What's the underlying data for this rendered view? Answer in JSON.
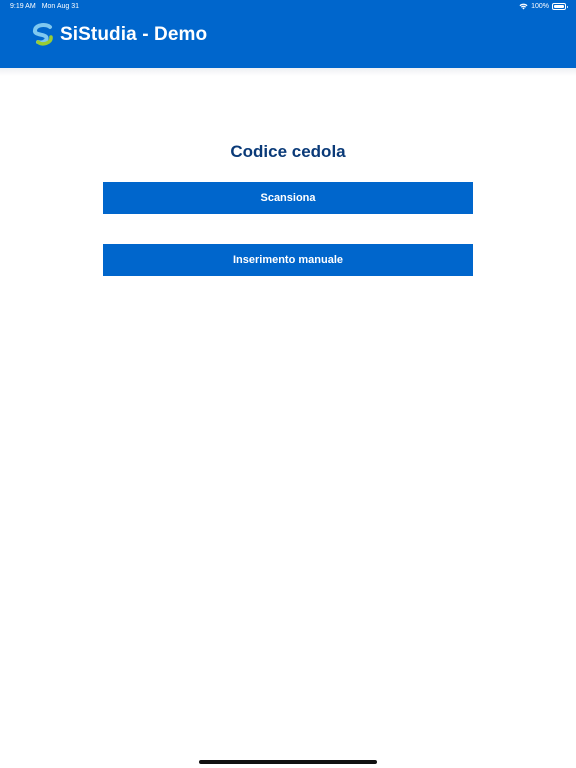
{
  "status_bar": {
    "time": "9:19 AM",
    "date": "Mon Aug 31",
    "battery": "100%",
    "wifi_icon": "wifi-icon",
    "battery_icon": "battery-icon"
  },
  "header": {
    "title": "SiStudia - Demo",
    "logo_icon": "sistudia-logo-icon",
    "background_color": "#0066cc"
  },
  "main": {
    "title": "Codice cedola",
    "title_color": "#0a3a78",
    "scan_button_label": "Scansiona",
    "manual_button_label": "Inserimento manuale",
    "button_color": "#0066cc"
  }
}
